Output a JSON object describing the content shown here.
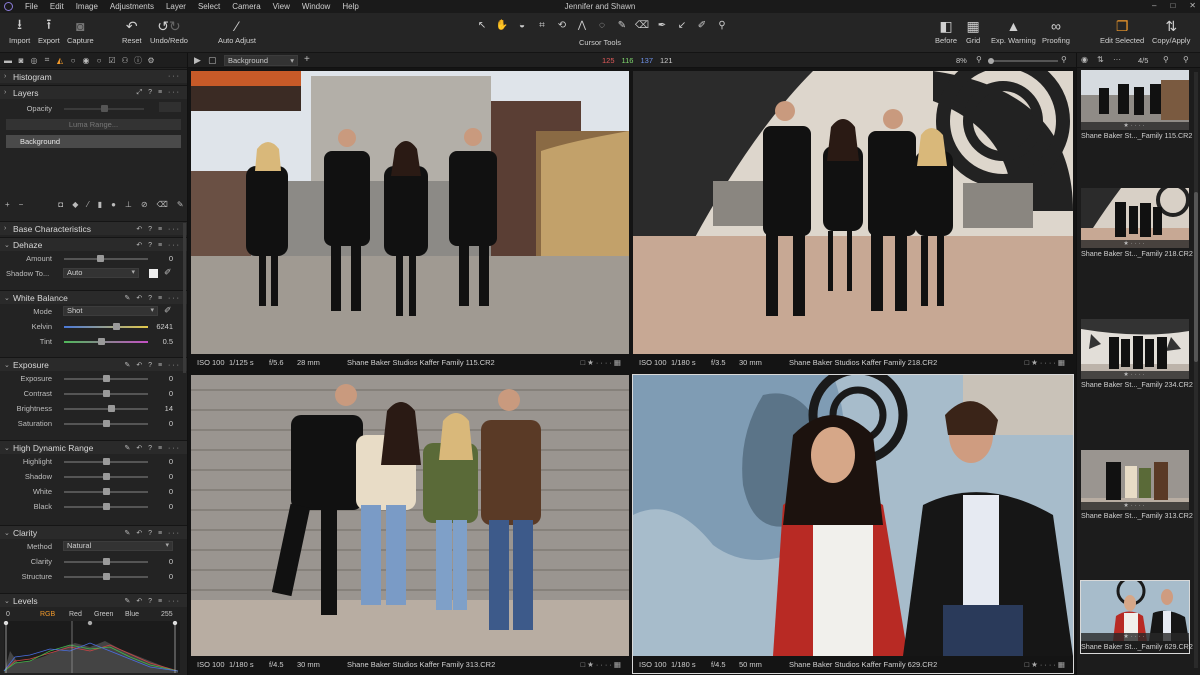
{
  "window": {
    "title": "Jennifer and Shawn"
  },
  "menu": [
    "File",
    "Edit",
    "Image",
    "Adjustments",
    "Layer",
    "Select",
    "Camera",
    "View",
    "Window",
    "Help"
  ],
  "window_controls": [
    "–",
    "□",
    "✕"
  ],
  "toolbar": {
    "import": "Import",
    "export": "Export",
    "capture": "Capture",
    "reset": "Reset",
    "undo_redo": "Undo/Redo",
    "auto_adjust": "Auto Adjust",
    "cursor_tools": "Cursor Tools",
    "before": "Before",
    "grid": "Grid",
    "exp_warning": "Exp. Warning",
    "proofing": "Proofing",
    "edit_selected": "Edit Selected",
    "copy_apply": "Copy/Apply"
  },
  "viewer_bar": {
    "layer_select": "Background",
    "r": "125",
    "g": "116",
    "b": "137",
    "l": "121",
    "zoom": "8%"
  },
  "filmstrip_head": {
    "counter": "4/5"
  },
  "left": {
    "histogram": "Histogram",
    "layers": {
      "title": "Layers",
      "opacity_label": "Opacity",
      "luma_range": "Luma Range...",
      "layer_name": "Background"
    },
    "base_characteristics": "Base Characteristics",
    "dehaze": {
      "title": "Dehaze",
      "amount_label": "Amount",
      "amount": "0",
      "shadow_label": "Shadow To...",
      "shadow_value": "Auto"
    },
    "white_balance": {
      "title": "White Balance",
      "mode_label": "Mode",
      "mode_value": "Shot",
      "kelvin_label": "Kelvin",
      "kelvin": "6241",
      "tint_label": "Tint",
      "tint": "0.5"
    },
    "exposure": {
      "title": "Exposure",
      "rows": [
        {
          "label": "Exposure",
          "value": "0",
          "pos": 0.5
        },
        {
          "label": "Contrast",
          "value": "0",
          "pos": 0.5
        },
        {
          "label": "Brightness",
          "value": "14",
          "pos": 0.57
        },
        {
          "label": "Saturation",
          "value": "0",
          "pos": 0.5
        }
      ]
    },
    "hdr": {
      "title": "High Dynamic Range",
      "rows": [
        {
          "label": "Highlight",
          "value": "0",
          "pos": 0.5
        },
        {
          "label": "Shadow",
          "value": "0",
          "pos": 0.5
        },
        {
          "label": "White",
          "value": "0",
          "pos": 0.5
        },
        {
          "label": "Black",
          "value": "0",
          "pos": 0.5
        }
      ]
    },
    "clarity": {
      "title": "Clarity",
      "method_label": "Method",
      "method_value": "Natural",
      "rows": [
        {
          "label": "Clarity",
          "value": "0",
          "pos": 0.5
        },
        {
          "label": "Structure",
          "value": "0",
          "pos": 0.5
        }
      ]
    },
    "levels": {
      "title": "Levels",
      "min": "0",
      "max": "255",
      "channels": [
        "RGB",
        "Red",
        "Green",
        "Blue"
      ]
    }
  },
  "photos": [
    {
      "iso": "ISO 100",
      "shutter": "1/125 s",
      "aperture": "f/5.6",
      "focal": "28 mm",
      "file": "Shane Baker Studios Kaffer Family 115.CR2"
    },
    {
      "iso": "ISO 100",
      "shutter": "1/180 s",
      "aperture": "f/3.5",
      "focal": "30 mm",
      "file": "Shane Baker Studios Kaffer Family 218.CR2"
    },
    {
      "iso": "ISO 100",
      "shutter": "1/180 s",
      "aperture": "f/4.5",
      "focal": "30 mm",
      "file": "Shane Baker Studios Kaffer Family 313.CR2"
    },
    {
      "iso": "ISO 100",
      "shutter": "1/180 s",
      "aperture": "f/4.5",
      "focal": "50 mm",
      "file": "Shane Baker Studios Kaffer Family 629.CR2"
    }
  ],
  "thumbs": [
    "Shane Baker St..._Family 115.CR2",
    "Shane Baker St..._Family 218.CR2",
    "Shane Baker St..._Family 234.CR2",
    "Shane Baker St..._Family 313.CR2",
    "Shane Baker St..._Family 629.CR2"
  ]
}
